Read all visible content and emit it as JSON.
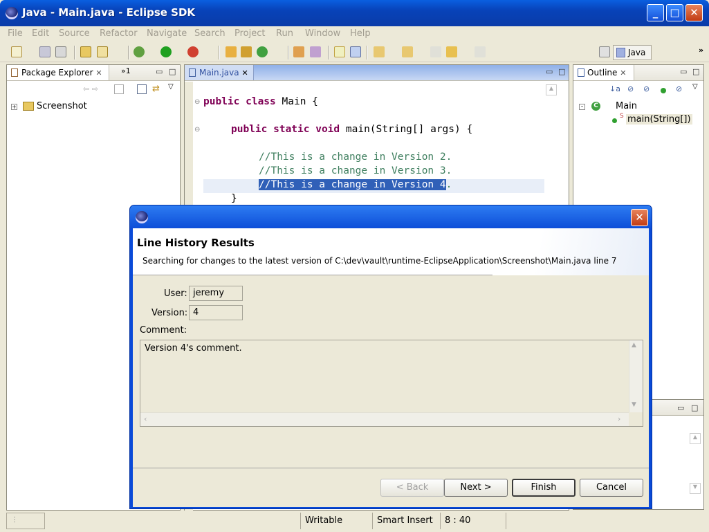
{
  "window": {
    "title": "Java - Main.java - Eclipse SDK"
  },
  "menu": [
    "File",
    "Edit",
    "Source",
    "Refactor",
    "Navigate",
    "Search",
    "Project",
    "Run",
    "Window",
    "Help"
  ],
  "perspective": {
    "label": "Java"
  },
  "package_explorer": {
    "tab_label": "Package Explorer",
    "overflow_label": "»1",
    "tree": [
      {
        "label": "Screenshot"
      }
    ]
  },
  "editor": {
    "tab_label": "Main.java",
    "lines": [
      {
        "kw": "public class ",
        "rest": "Main {"
      },
      {
        "kw": "public static void ",
        "rest": "main(String[] args) {"
      },
      {
        "comment": "//This is a change in Version 2."
      },
      {
        "comment": "//This is a change in Version 3."
      },
      {
        "comment": "//This is a change in Version 4",
        "after": "."
      },
      {
        "rest": "}"
      }
    ]
  },
  "outline": {
    "tab_label": "Outline",
    "class_name": "Main",
    "method_name": "main(String[])",
    "method_badge": "S"
  },
  "dialog": {
    "heading": "Line History Results",
    "description": "Searching for changes to the latest version of C:\\dev\\vault\\runtime-EclipseApplication\\Screenshot\\Main.java  line 7",
    "user_label": "User:",
    "user_value": "jeremy",
    "version_label": "Version:",
    "version_value": "4",
    "comment_label": "Comment:",
    "comment_value": "Version 4's comment.",
    "buttons": {
      "back": "< Back",
      "next": "Next >",
      "finish": "Finish",
      "cancel": "Cancel"
    }
  },
  "statusbar": {
    "writable": "Writable",
    "insert_mode": "Smart Insert",
    "position": "8 : 40"
  }
}
